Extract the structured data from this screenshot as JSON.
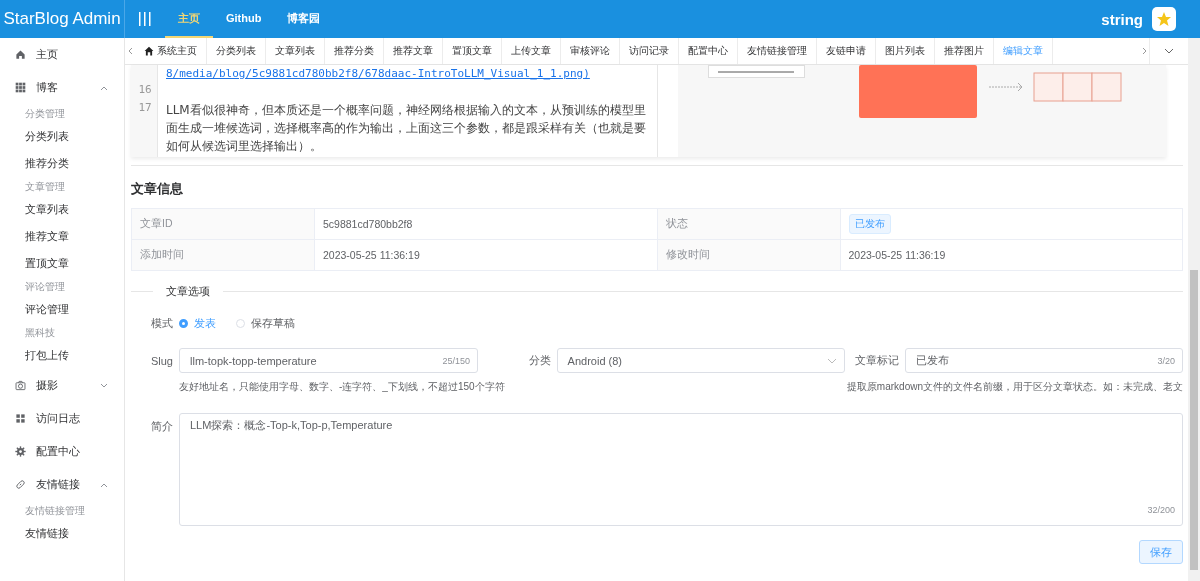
{
  "header": {
    "brand": "StarBlog Admin",
    "nav": [
      {
        "label": "主页",
        "selected": true
      },
      {
        "label": "Github",
        "selected": false
      },
      {
        "label": "博客园",
        "selected": false
      }
    ],
    "user": "string"
  },
  "sidebar": {
    "items": [
      {
        "kind": "item",
        "label": "主页"
      },
      {
        "kind": "submenu",
        "label": "博客",
        "expanded": true,
        "children": [
          {
            "label": "分类管理",
            "children": [
              {
                "label": "分类列表"
              },
              {
                "label": "推荐分类"
              }
            ]
          },
          {
            "label": "文章管理",
            "children": [
              {
                "label": "文章列表"
              },
              {
                "label": "推荐文章"
              },
              {
                "label": "置顶文章"
              }
            ]
          },
          {
            "label": "评论管理",
            "children": [
              {
                "label": "评论管理"
              }
            ]
          },
          {
            "label": "黑科技",
            "children": [
              {
                "label": "打包上传"
              }
            ]
          }
        ]
      },
      {
        "kind": "submenu",
        "label": "摄影",
        "expanded": false
      },
      {
        "kind": "item",
        "label": "访问日志"
      },
      {
        "kind": "item",
        "label": "配置中心"
      },
      {
        "kind": "submenu",
        "label": "友情链接",
        "expanded": true,
        "children": [
          {
            "label": "友情链接管理",
            "children": [
              {
                "label": "友情链接"
              }
            ]
          }
        ]
      }
    ]
  },
  "tabs": [
    {
      "label": "系统主页",
      "selected": false
    },
    {
      "label": "分类列表",
      "selected": false
    },
    {
      "label": "文章列表",
      "selected": false
    },
    {
      "label": "推荐分类",
      "selected": false
    },
    {
      "label": "推荐文章",
      "selected": false
    },
    {
      "label": "置顶文章",
      "selected": false
    },
    {
      "label": "上传文章",
      "selected": false
    },
    {
      "label": "审核评论",
      "selected": false
    },
    {
      "label": "访问记录",
      "selected": false
    },
    {
      "label": "配置中心",
      "selected": false
    },
    {
      "label": "友情链接管理",
      "selected": false
    },
    {
      "label": "友链申请",
      "selected": false
    },
    {
      "label": "图片列表",
      "selected": false
    },
    {
      "label": "推荐图片",
      "selected": false
    },
    {
      "label": "编辑文章",
      "selected": true
    }
  ],
  "editor": {
    "lines": [
      {
        "kind": "link",
        "text": "8/media/blog/5c9881cd780bb2f8/678daac-IntroToLLM_Visual_1_1.png)"
      },
      {
        "kind": "blank",
        "number": "16"
      },
      {
        "kind": "text",
        "number": "17",
        "text": "LLM看似很神奇，但本质还是一个概率问题，神经网络根据输入的文本，从预训练的模型里面生成一堆候选词，选择概率高的作为输出，上面这三个参数，都是跟采样有关（也就是要如何从候选词里选择输出）。"
      }
    ]
  },
  "info": {
    "title": "文章信息",
    "rows": [
      [
        {
          "label": "文章ID",
          "kind": "text",
          "value": "5c9881cd780bb2f8"
        },
        {
          "label": "状态",
          "kind": "tag",
          "value": "已发布"
        }
      ],
      [
        {
          "label": "添加时间",
          "kind": "text",
          "value": "2023-05-25 11:36:19"
        },
        {
          "label": "修改时间",
          "kind": "text",
          "value": "2023-05-25 11:36:19"
        }
      ]
    ]
  },
  "options": {
    "divider": "文章选项",
    "mode": {
      "label": "模式",
      "options": [
        {
          "label": "发表",
          "selected": true
        },
        {
          "label": "保存草稿",
          "selected": false
        }
      ]
    },
    "slug": {
      "label": "Slug",
      "value": "llm-topk-topp-temperature",
      "count": "25/150",
      "hint": "友好地址名，只能使用字母、数字、-连字符、_下划线，不超过150个字符"
    },
    "category": {
      "label": "分类",
      "value": "Android (8)"
    },
    "mark": {
      "label": "文章标记",
      "value": "已发布",
      "count": "3/20",
      "hint": "提取原markdown文件的文件名前缀，用于区分文章状态。如：未完成、老文"
    },
    "summary": {
      "label": "简介",
      "value": "LLM探索：概念-Top-k,Top-p,Temperature",
      "count": "32/200"
    },
    "save": "保存"
  }
}
